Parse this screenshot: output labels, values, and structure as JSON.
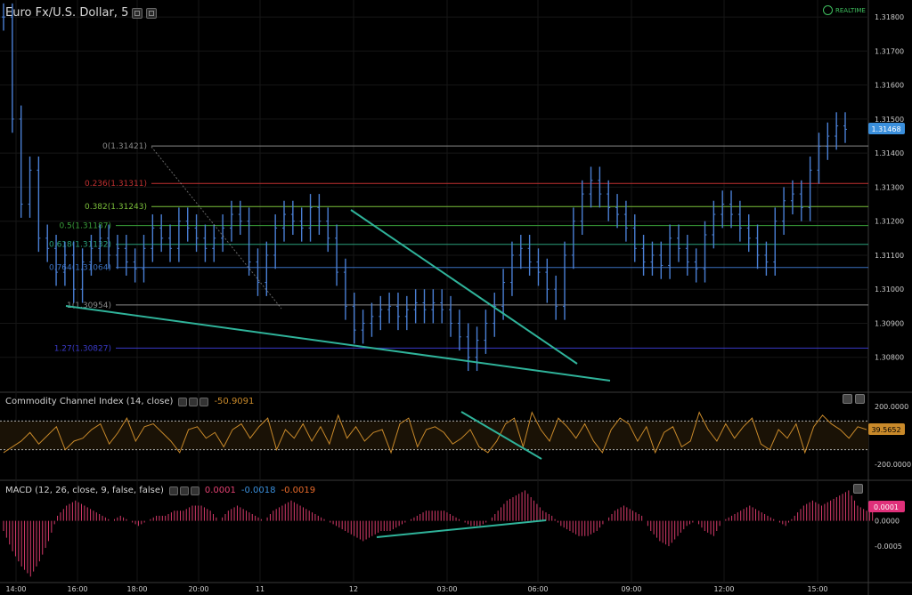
{
  "header": {
    "title": "Euro Fx/U.S. Dollar, 5",
    "realtime": "REALTIME"
  },
  "colors": {
    "background": "#000000",
    "candle": "#4a7fd4",
    "grid": "#1a1a1a",
    "trendline": "#2fb39a",
    "cci_line": "#c8892a",
    "macd_hist": "#d63a6a",
    "last_price": "#3a8fdc"
  },
  "chart_data": [
    {
      "type": "line",
      "name": "price",
      "title": "Euro Fx/U.S. Dollar, 5",
      "ylim": [
        1.307,
        1.3185
      ],
      "y_ticks": [
        "1.31800",
        "1.31700",
        "1.31600",
        "1.31500",
        "1.31400",
        "1.31300",
        "1.31200",
        "1.31100",
        "1.31000",
        "1.30900",
        "1.30800"
      ],
      "x_ticks": [
        "14:00",
        "16:00",
        "18:00",
        "20:00",
        "11",
        "12",
        "03:00",
        "06:00",
        "09:00",
        "12:00",
        "15:00"
      ],
      "last_price": "1.31468",
      "fib_levels": [
        {
          "label": "0(1.31421)",
          "value": 1.31421,
          "color": "#8a8a8a"
        },
        {
          "label": "0.236(1.31311)",
          "value": 1.31311,
          "color": "#c03030"
        },
        {
          "label": "0.382(1.31243)",
          "value": 1.31243,
          "color": "#7bbf3a"
        },
        {
          "label": "0.5(1.31187)",
          "value": 1.31187,
          "color": "#3aa03a"
        },
        {
          "label": "0.618(1.31132)",
          "value": 1.31132,
          "color": "#2aa07a"
        },
        {
          "label": "0.764(1.31064)",
          "value": 1.31064,
          "color": "#3a70c0"
        },
        {
          "label": "1(1.30954)",
          "value": 1.30954,
          "color": "#8a8a8a"
        },
        {
          "label": "1.27(1.30827)",
          "value": 1.30827,
          "color": "#3a3ac8"
        }
      ],
      "series": [
        {
          "values": [
            1.318,
            1.315,
            1.3125,
            1.3135,
            1.3115,
            1.3112,
            1.3105,
            1.311,
            1.31,
            1.3108,
            1.3112,
            1.3115,
            1.311,
            1.3112,
            1.3108,
            1.3106,
            1.3112,
            1.3118,
            1.3115,
            1.3112,
            1.312,
            1.3118,
            1.3115,
            1.3112,
            1.3115,
            1.3118,
            1.3122,
            1.312,
            1.3108,
            1.3102,
            1.311,
            1.3118,
            1.3122,
            1.312,
            1.3118,
            1.3124,
            1.312,
            1.3115,
            1.3105,
            1.3095,
            1.3088,
            1.309,
            1.3092,
            1.3094,
            1.3095,
            1.3092,
            1.3094,
            1.3096,
            1.3094,
            1.3096,
            1.3094,
            1.309,
            1.3086,
            1.308,
            1.3085,
            1.309,
            1.3095,
            1.3102,
            1.311,
            1.3112,
            1.3108,
            1.3105,
            1.31,
            1.3095,
            1.311,
            1.312,
            1.3128,
            1.3132,
            1.3128,
            1.3124,
            1.3122,
            1.3118,
            1.3112,
            1.3108,
            1.311,
            1.3107,
            1.3115,
            1.3112,
            1.3108,
            1.3106,
            1.3116,
            1.3122,
            1.3125,
            1.3122,
            1.3118,
            1.3115,
            1.311,
            1.3108,
            1.312,
            1.3126,
            1.3128,
            1.3124,
            1.3135,
            1.3142,
            1.3145,
            1.3148,
            1.3147
          ]
        }
      ]
    },
    {
      "type": "line",
      "name": "cci",
      "title": "Commodity Channel Index (14, close)",
      "value_label": "-50.9091",
      "last_label": "39.5652",
      "ylim": [
        -300,
        300
      ],
      "y_ticks": [
        "200.0000",
        "-200.0000"
      ],
      "levels": [
        100,
        -100
      ],
      "series": [
        {
          "values": [
            -120,
            -80,
            -40,
            20,
            -60,
            0,
            60,
            -100,
            -40,
            -20,
            40,
            80,
            -60,
            20,
            120,
            -40,
            60,
            80,
            20,
            -40,
            -120,
            40,
            60,
            -20,
            20,
            -80,
            40,
            80,
            -20,
            60,
            120,
            -100,
            40,
            -20,
            80,
            -40,
            60,
            -60,
            140,
            -20,
            60,
            -40,
            20,
            40,
            -120,
            80,
            120,
            -80,
            40,
            60,
            20,
            -60,
            -20,
            40,
            -80,
            -120,
            -40,
            80,
            120,
            -80,
            160,
            40,
            -40,
            120,
            60,
            -20,
            80,
            -40,
            -120,
            40,
            120,
            80,
            -40,
            60,
            -120,
            20,
            60,
            -80,
            -40,
            160,
            40,
            -40,
            80,
            -20,
            60,
            120,
            -60,
            -100,
            40,
            -20,
            80,
            -120,
            60,
            140,
            80,
            40,
            -20,
            60,
            40
          ]
        }
      ]
    },
    {
      "type": "bar",
      "name": "macd",
      "title": "MACD (12, 26, close, 9, false, false)",
      "values_text": [
        "0.0001",
        "-0.0018",
        "-0.0019"
      ],
      "last_label": "0.0001",
      "ylim": [
        -0.0012,
        0.0008
      ],
      "y_ticks": [
        "0.0000",
        "-0.0005"
      ],
      "series": [
        {
          "values": [
            -0.0002,
            -0.0006,
            -0.0009,
            -0.0011,
            -0.0008,
            -0.0004,
            0.0001,
            0.0003,
            0.0004,
            0.0003,
            0.0002,
            0.0001,
            0.0,
            0.0001,
            0.0,
            -0.0001,
            0.0,
            0.0001,
            0.0001,
            0.0002,
            0.0002,
            0.0003,
            0.0003,
            0.0002,
            0.0,
            0.0002,
            0.0003,
            0.0002,
            0.0001,
            0.0,
            0.0002,
            0.0003,
            0.0004,
            0.0003,
            0.0002,
            0.0001,
            0.0,
            -0.0001,
            -0.0002,
            -0.0003,
            -0.0004,
            -0.0003,
            -0.0002,
            -0.0002,
            -0.0001,
            0.0,
            0.0001,
            0.0002,
            0.0002,
            0.0002,
            0.0001,
            0.0,
            -0.0001,
            -0.0001,
            0.0,
            0.0002,
            0.0004,
            0.0005,
            0.0006,
            0.0004,
            0.0002,
            0.0001,
            -0.0001,
            -0.0002,
            -0.0003,
            -0.0003,
            -0.0002,
            0.0,
            0.0002,
            0.0003,
            0.0002,
            0.0001,
            -0.0002,
            -0.0004,
            -0.0005,
            -0.0003,
            -0.0001,
            0.0,
            -0.0002,
            -0.0003,
            0.0,
            0.0001,
            0.0002,
            0.0003,
            0.0002,
            0.0001,
            0.0,
            -0.0001,
            0.0001,
            0.0003,
            0.0004,
            0.0003,
            0.0004,
            0.0005,
            0.0006,
            0.0003,
            0.0002
          ]
        }
      ]
    }
  ]
}
